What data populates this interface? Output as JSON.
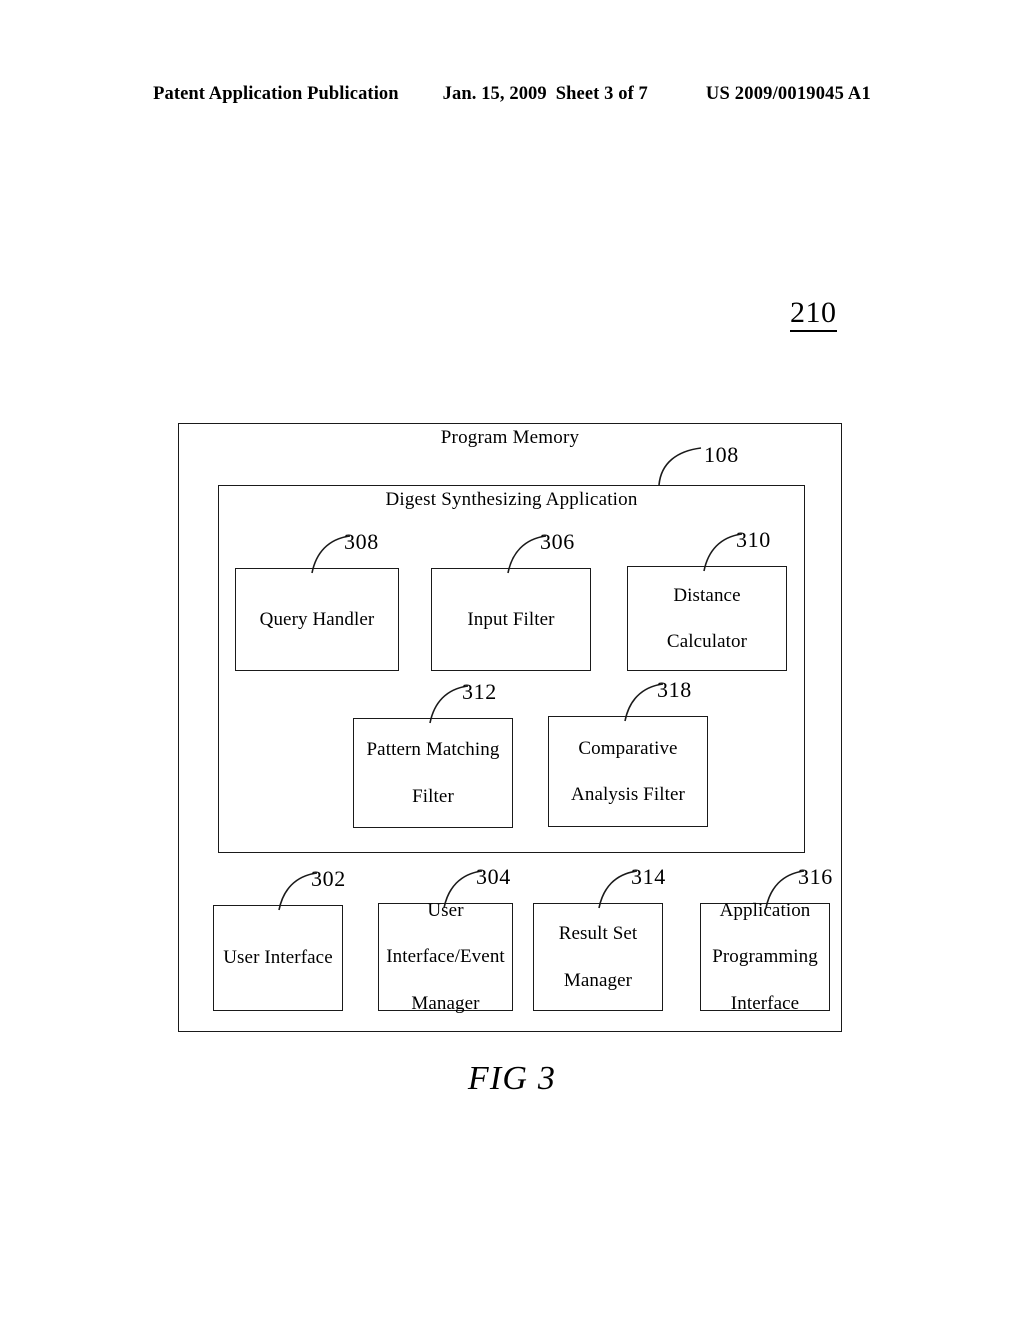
{
  "header": {
    "publication": "Patent Application Publication",
    "date": "Jan. 15, 2009",
    "sheet": "Sheet 3 of 7",
    "patent_number": "US 2009/0019045 A1"
  },
  "figure": {
    "system_ref": "210",
    "caption": "FIG 3"
  },
  "diagram": {
    "outer_title": "Program Memory",
    "inner_title": "Digest Synthesizing Application",
    "inner_ref": "108",
    "row1": [
      {
        "ref": "308",
        "label": "Query Handler"
      },
      {
        "ref": "306",
        "label": "Input Filter"
      },
      {
        "ref": "310",
        "label_line1": "Distance",
        "label_line2": "Calculator"
      }
    ],
    "row2": [
      {
        "ref": "312",
        "label_line1": "Pattern Matching",
        "label_line2": "Filter"
      },
      {
        "ref": "318",
        "label_line1": "Comparative",
        "label_line2": "Analysis Filter"
      }
    ],
    "row3": [
      {
        "ref": "302",
        "label": "User Interface"
      },
      {
        "ref": "304",
        "label_line1": "User",
        "label_line2": "Interface/Event",
        "label_line3": "Manager"
      },
      {
        "ref": "314",
        "label_line1": "Result Set",
        "label_line2": "Manager"
      },
      {
        "ref": "316",
        "label_line1": "Application",
        "label_line2": "Programming",
        "label_line3": "Interface"
      }
    ]
  },
  "colors": {
    "ink": "#1a1a1a",
    "paper": "#ffffff"
  }
}
